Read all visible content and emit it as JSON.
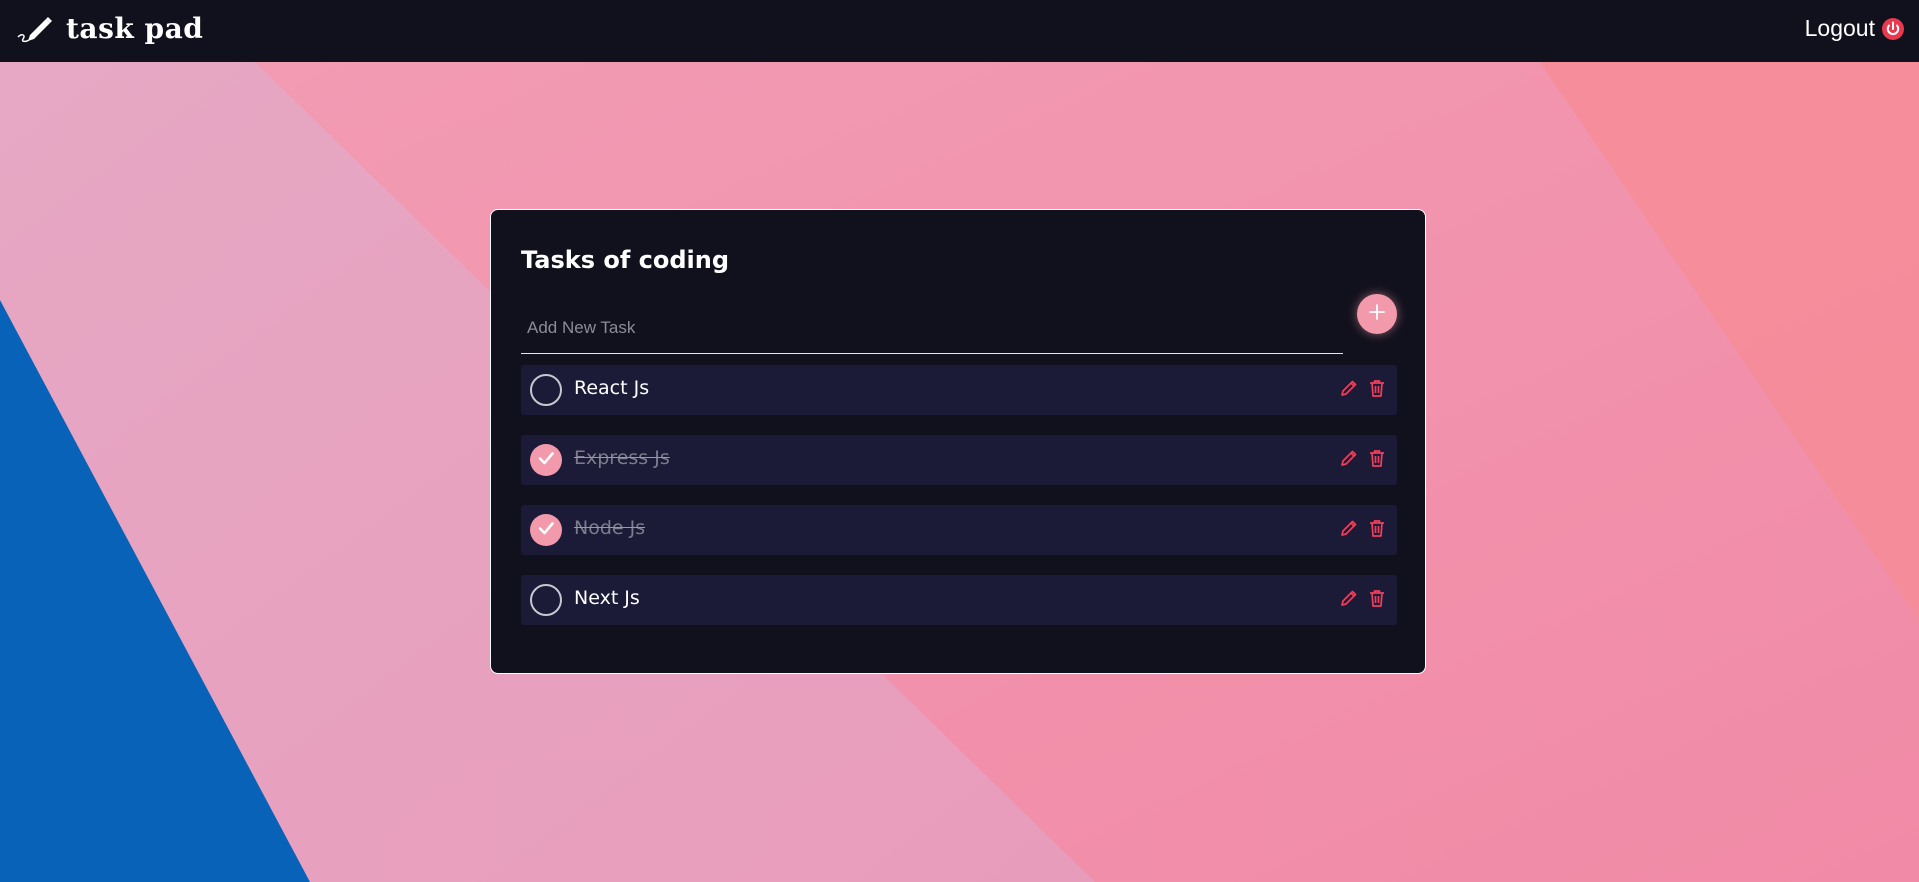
{
  "app": {
    "brand": "task pad",
    "logout_label": "Logout"
  },
  "card": {
    "title": "Tasks of coding",
    "input_placeholder": "Add New Task",
    "input_value": ""
  },
  "tasks": [
    {
      "label": "React Js",
      "completed": false
    },
    {
      "label": "Express Js",
      "completed": true
    },
    {
      "label": "Node Js",
      "completed": true
    },
    {
      "label": "Next Js",
      "completed": false
    }
  ],
  "icons": {
    "brand": "pen-icon",
    "logout": "power-icon",
    "add": "plus-icon",
    "edit": "pencil-icon",
    "delete": "trash-icon",
    "check": "checkmark-icon"
  },
  "colors": {
    "nav_bg": "#11111d",
    "card_bg": "#11111d",
    "row_bg": "#1b1a37",
    "accent": "#f29aab",
    "action_red": "#ef3f5a",
    "logout_icon": "#e8394e",
    "bg_pink": "#f29ab3",
    "bg_blue": "#0862b8"
  }
}
